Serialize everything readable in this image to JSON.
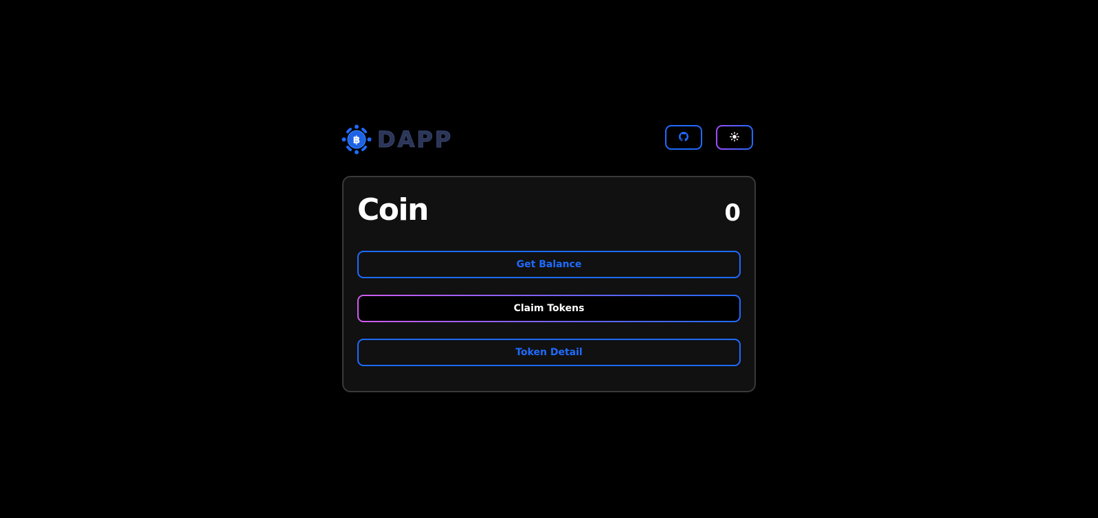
{
  "header": {
    "logo_text": "DAPP",
    "logo_symbol": "฿",
    "github_button_icon": "github-icon",
    "theme_button_icon": "sun-icon"
  },
  "card": {
    "title": "Coin",
    "balance": "0",
    "buttons": [
      {
        "label": "Get Balance"
      },
      {
        "label": "Claim Tokens"
      },
      {
        "label": "Token Detail"
      }
    ]
  },
  "colors": {
    "background": "#000000",
    "card_background": "#111111",
    "card_border": "#3a3a3a",
    "accent_blue": "#1f6bff",
    "accent_purple": "#a04dff",
    "accent_pink": "#d25cf0",
    "logo_text": "#2b3557"
  }
}
